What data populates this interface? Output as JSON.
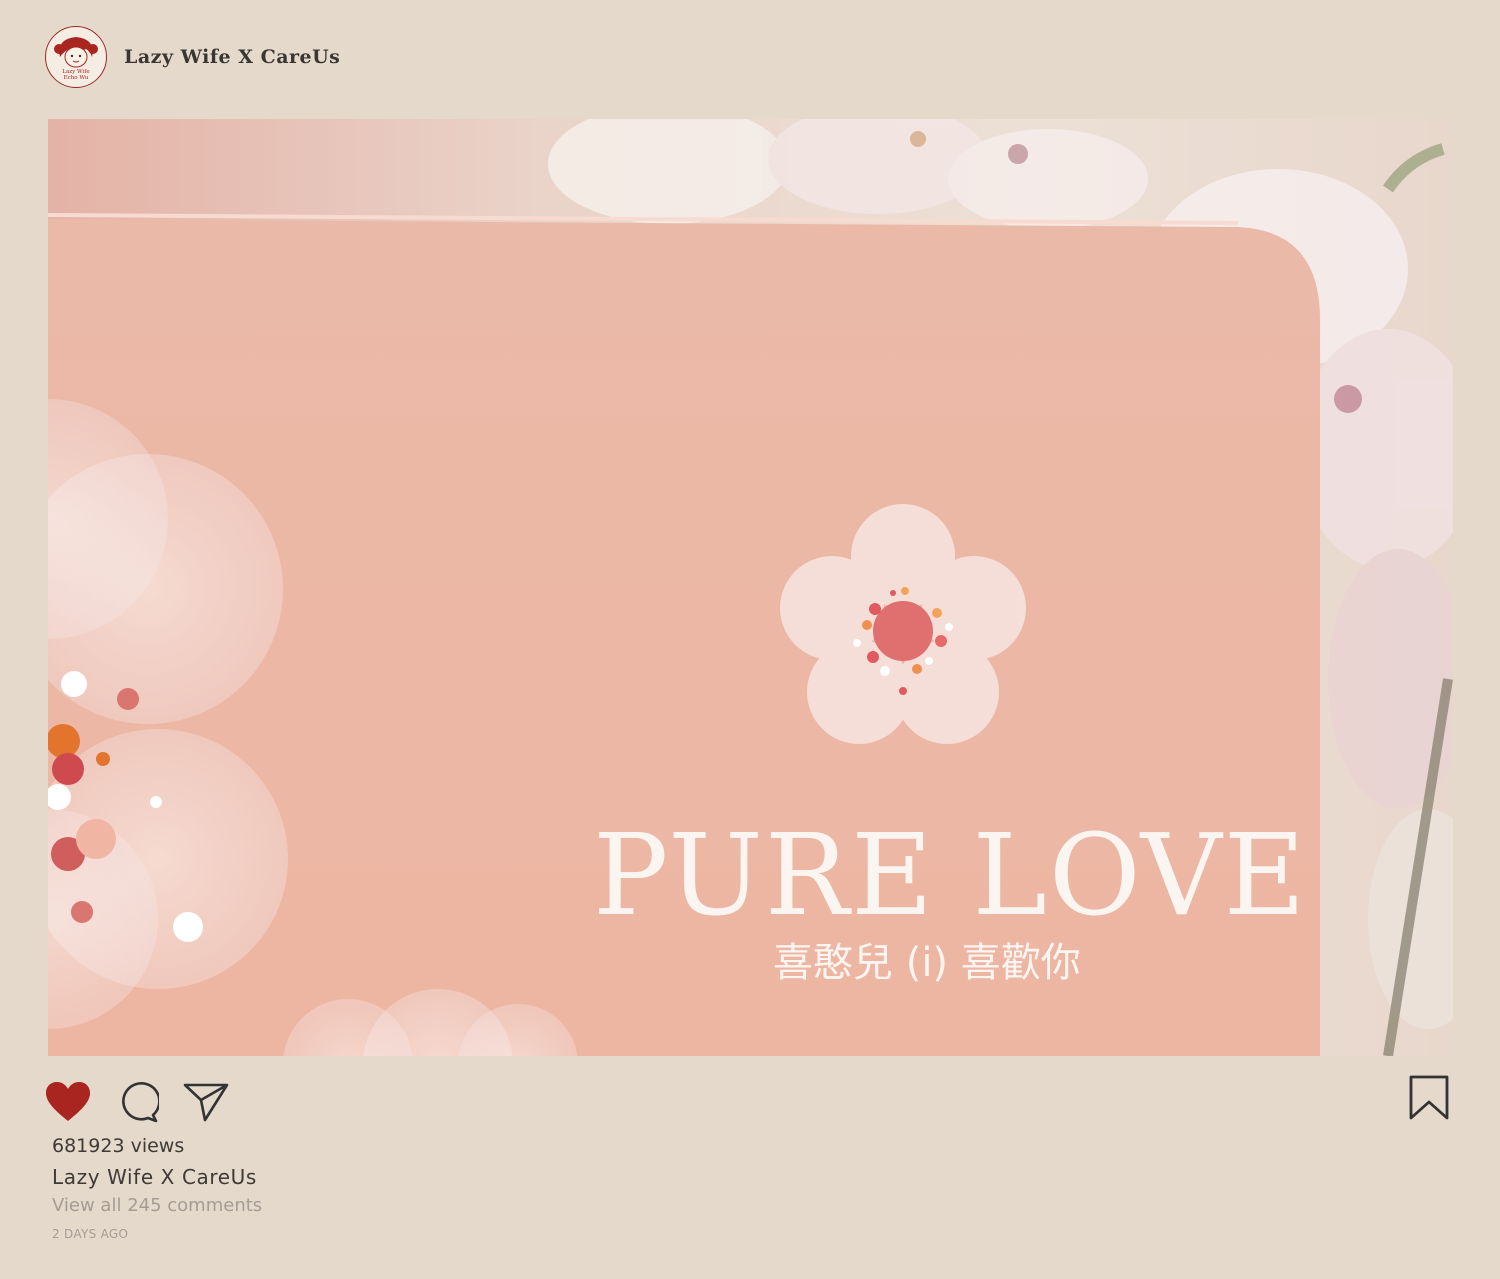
{
  "post": {
    "username": "Lazy Wife X CareUs",
    "avatar": {
      "line1": "Lazy Wife",
      "line2": "Echo Wu"
    },
    "photo": {
      "title": "PURE LOVE",
      "subtitle": "喜憨兒 (i) 喜歡你"
    },
    "views": "681923 views",
    "caption_user": "Lazy Wife X CareUs",
    "comments_link": "View all 245 comments",
    "timestamp": "2 DAYS AGO"
  },
  "icons": {
    "like": "heart-icon",
    "comment": "comment-bubble-icon",
    "share": "send-plane-icon",
    "save": "bookmark-icon"
  },
  "colors": {
    "background": "#e5d9cc",
    "like_active": "#a8261f",
    "box_pink": "#ebb6a3",
    "avatar_border": "#9e2b25"
  }
}
